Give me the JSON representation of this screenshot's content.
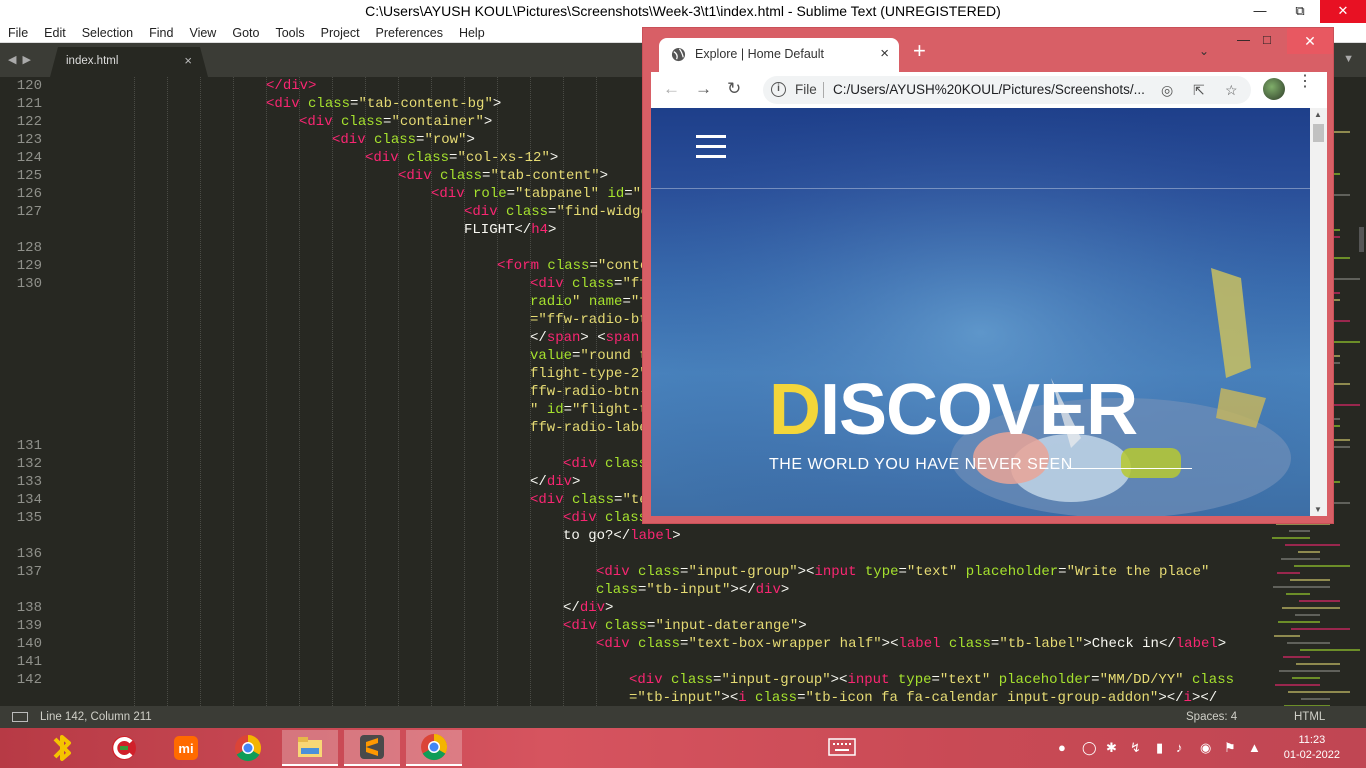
{
  "sublime": {
    "title": "C:\\Users\\AYUSH KOUL\\Pictures\\Screenshots\\Week-3\\t1\\index.html - Sublime Text (UNREGISTERED)",
    "menu": [
      "File",
      "Edit",
      "Selection",
      "Find",
      "View",
      "Goto",
      "Tools",
      "Project",
      "Preferences",
      "Help"
    ],
    "tab": {
      "label": "index.html",
      "close": "×"
    },
    "status": {
      "position": "Line 142, Column 211",
      "spaces": "Spaces: 4",
      "syntax": "HTML"
    },
    "line_numbers": [
      "120",
      "121",
      "122",
      "123",
      "124",
      "125",
      "126",
      "127",
      "",
      "128",
      "129",
      "130",
      "",
      "",
      "",
      "",
      "",
      "",
      "",
      "",
      "131",
      "132",
      "133",
      "134",
      "135",
      "",
      "136",
      "137",
      "",
      "138",
      "139",
      "140",
      "141",
      "142",
      ""
    ],
    "code_lines": [
      [
        [
          "t",
          "</"
        ],
        [
          "t",
          "div"
        ],
        [
          "t",
          ">"
        ]
      ],
      [
        [
          "t",
          "<div "
        ],
        [
          "a",
          "class"
        ],
        [
          "p",
          "="
        ],
        [
          "s",
          "\"tab-content-bg\""
        ],
        [
          "p",
          ">"
        ]
      ],
      [
        [
          "t",
          "<div "
        ],
        [
          "a",
          "class"
        ],
        [
          "p",
          "="
        ],
        [
          "s",
          "\"container\""
        ],
        [
          "p",
          ">"
        ]
      ],
      [
        [
          "t",
          "<div "
        ],
        [
          "a",
          "class"
        ],
        [
          "p",
          "="
        ],
        [
          "s",
          "\"row\""
        ],
        [
          "p",
          ">"
        ]
      ],
      [
        [
          "t",
          "<div "
        ],
        [
          "a",
          "class"
        ],
        [
          "p",
          "="
        ],
        [
          "s",
          "\"col-xs-12\""
        ],
        [
          "p",
          ">"
        ]
      ],
      [
        [
          "t",
          "<div "
        ],
        [
          "a",
          "class"
        ],
        [
          "p",
          "="
        ],
        [
          "s",
          "\"tab-content\""
        ],
        [
          "p",
          ">"
        ]
      ],
      [
        [
          "t",
          "<div "
        ],
        [
          "a",
          "role"
        ],
        [
          "p",
          "="
        ],
        [
          "s",
          "\"tabpanel\""
        ],
        [
          "p",
          " "
        ],
        [
          "a",
          "id"
        ],
        [
          "p",
          "="
        ],
        [
          "s",
          "\"f"
        ]
      ],
      [
        [
          "t",
          "<div "
        ],
        [
          "a",
          "class"
        ],
        [
          "p",
          "="
        ],
        [
          "s",
          "\"find-widge"
        ]
      ],
      [
        [
          "p",
          "FLIGHT</"
        ],
        [
          "t",
          "h4"
        ],
        [
          "p",
          ">"
        ]
      ],
      [],
      [
        [
          "t",
          "<form "
        ],
        [
          "a",
          "class"
        ],
        [
          "p",
          "="
        ],
        [
          "s",
          "\"conte"
        ]
      ],
      [
        [
          "t",
          "<div "
        ],
        [
          "a",
          "class"
        ],
        [
          "p",
          "="
        ],
        [
          "s",
          "\"ff"
        ]
      ],
      [
        [
          "a",
          "radio"
        ],
        [
          "s",
          "\" "
        ],
        [
          "a",
          "name"
        ],
        [
          "p",
          "="
        ],
        [
          "s",
          "\"f"
        ]
      ],
      [
        [
          "s",
          "=\"ffw-radio-bt"
        ]
      ],
      [
        [
          "p",
          "</"
        ],
        [
          "t",
          "span"
        ],
        [
          "p",
          "> <"
        ],
        [
          "t",
          "span"
        ]
      ],
      [
        [
          "a",
          "value"
        ],
        [
          "p",
          "="
        ],
        [
          "s",
          "\"round t"
        ]
      ],
      [
        [
          "s",
          "flight-type-2\""
        ]
      ],
      [
        [
          "s",
          "ffw-radio-btn-"
        ]
      ],
      [
        [
          "s",
          "\" "
        ],
        [
          "a",
          "id"
        ],
        [
          "p",
          "="
        ],
        [
          "s",
          "\"flight-t"
        ]
      ],
      [
        [
          "s",
          "ffw-radio-labe"
        ]
      ],
      [],
      [
        [
          "t",
          "<div "
        ],
        [
          "a",
          "class"
        ]
      ],
      [
        [
          "p",
          "</"
        ],
        [
          "t",
          "div"
        ],
        [
          "p",
          ">"
        ]
      ],
      [
        [
          "t",
          "<div "
        ],
        [
          "a",
          "class"
        ],
        [
          "p",
          "="
        ],
        [
          "s",
          "\"te"
        ]
      ],
      [
        [
          "t",
          "<div "
        ],
        [
          "a",
          "class"
        ]
      ],
      [
        [
          "p",
          "to go?</"
        ],
        [
          "t",
          "label"
        ],
        [
          "p",
          ">"
        ]
      ],
      [],
      [
        [
          "t",
          "<div "
        ],
        [
          "a",
          "class"
        ],
        [
          "p",
          "="
        ],
        [
          "s",
          "\"input-group\""
        ],
        [
          "p",
          "><"
        ],
        [
          "t",
          "input "
        ],
        [
          "a",
          "type"
        ],
        [
          "p",
          "="
        ],
        [
          "s",
          "\"text\""
        ],
        [
          "p",
          " "
        ],
        [
          "a",
          "placeholder"
        ],
        [
          "p",
          "="
        ],
        [
          "s",
          "\"Write the place\""
        ]
      ],
      [
        [
          "a",
          "class"
        ],
        [
          "p",
          "="
        ],
        [
          "s",
          "\"tb-input\""
        ],
        [
          "p",
          "></"
        ],
        [
          "t",
          "div"
        ],
        [
          "p",
          ">"
        ]
      ],
      [
        [
          "p",
          "</"
        ],
        [
          "t",
          "div"
        ],
        [
          "p",
          ">"
        ]
      ],
      [
        [
          "t",
          "<div "
        ],
        [
          "a",
          "class"
        ],
        [
          "p",
          "="
        ],
        [
          "s",
          "\"input-daterange\""
        ],
        [
          "p",
          ">"
        ]
      ],
      [
        [
          "t",
          "<div "
        ],
        [
          "a",
          "class"
        ],
        [
          "p",
          "="
        ],
        [
          "s",
          "\"text-box-wrapper half\""
        ],
        [
          "p",
          "><"
        ],
        [
          "t",
          "label "
        ],
        [
          "a",
          "class"
        ],
        [
          "p",
          "="
        ],
        [
          "s",
          "\"tb-label\""
        ],
        [
          "p",
          ">Check in</"
        ],
        [
          "t",
          "label"
        ],
        [
          "p",
          ">"
        ]
      ],
      [],
      [
        [
          "t",
          "<div "
        ],
        [
          "a",
          "class"
        ],
        [
          "p",
          "="
        ],
        [
          "s",
          "\"input-group\""
        ],
        [
          "p",
          "><"
        ],
        [
          "t",
          "input "
        ],
        [
          "a",
          "type"
        ],
        [
          "p",
          "="
        ],
        [
          "s",
          "\"text\""
        ],
        [
          "p",
          " "
        ],
        [
          "a",
          "placeholder"
        ],
        [
          "p",
          "="
        ],
        [
          "s",
          "\"MM/DD/YY\""
        ],
        [
          "p",
          " "
        ],
        [
          "a",
          "class"
        ]
      ],
      [
        [
          "s",
          "=\"tb-input\""
        ],
        [
          "p",
          "><"
        ],
        [
          "t",
          "i "
        ],
        [
          "a",
          "class"
        ],
        [
          "p",
          "="
        ],
        [
          "s",
          "\"tb-icon fa fa-calendar input-group-addon\""
        ],
        [
          "p",
          "></"
        ],
        [
          "t",
          "i"
        ],
        [
          "p",
          "></"
        ]
      ]
    ]
  },
  "chrome": {
    "tab_title": "Explore | Home Default",
    "tab_close": "×",
    "new_tab": "+",
    "scheme_label": "File",
    "url": "C:/Users/AYUSH%20KOUL/Pictures/Screenshots/...",
    "page": {
      "headline_first": "D",
      "headline_rest": "ISCOVER",
      "subtitle": "THE WORLD YOU HAVE NEVER SEEN"
    }
  },
  "taskbar": {
    "time": "11:23",
    "date": "01-02-2022",
    "apps": [
      "bluetooth-app-icon",
      "ccleaner-icon",
      "mi-icon",
      "chrome-icon",
      "file-explorer-icon",
      "sublime-text-icon",
      "chrome-active-icon"
    ]
  },
  "colors": {
    "accent_yellow": "#f4d63a",
    "chrome_frame": "#d85f66",
    "editor_bg": "#272822"
  }
}
